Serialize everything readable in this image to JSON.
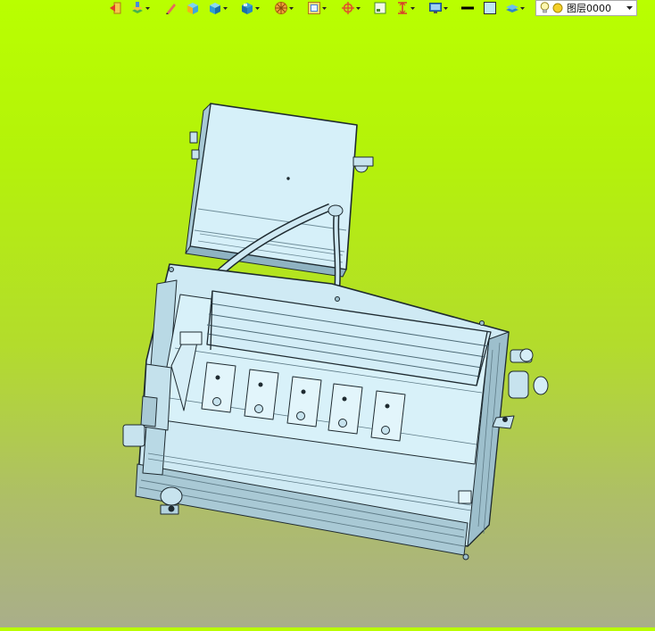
{
  "toolbar": {
    "tools": [
      {
        "icon": "exit-arrow-icon",
        "dropdown": false
      },
      {
        "icon": "layer-stack-icon",
        "dropdown": true
      },
      {
        "icon": "pencil-icon",
        "dropdown": false
      },
      {
        "icon": "shaded-box-icon",
        "dropdown": false
      },
      {
        "icon": "solid-cube-icon",
        "dropdown": true
      },
      {
        "icon": "view-cube-icon",
        "dropdown": true
      },
      {
        "icon": "section-wheel-icon",
        "dropdown": true
      },
      {
        "icon": "zoom-fit-icon",
        "dropdown": true
      },
      {
        "icon": "crosshair-icon",
        "dropdown": true
      },
      {
        "icon": "select-box-icon",
        "dropdown": false
      },
      {
        "icon": "measure-icon",
        "dropdown": true
      },
      {
        "icon": "monitor-icon",
        "dropdown": true
      },
      {
        "icon": "line-weight-icon",
        "dropdown": false
      },
      {
        "icon": "color-swatch-icon",
        "dropdown": false
      },
      {
        "icon": "layer-plane-icon",
        "dropdown": true
      }
    ],
    "layer_selector": {
      "value": "图层0000",
      "icons": [
        "lightbulb-icon",
        "sun-icon"
      ]
    }
  },
  "colors": {
    "background_top": "#b9ff00",
    "background_bottom": "#a9ae8a",
    "model_face": "#d4eef7",
    "model_edge": "#1e2a30",
    "model_shade": "#8fb3c2"
  }
}
